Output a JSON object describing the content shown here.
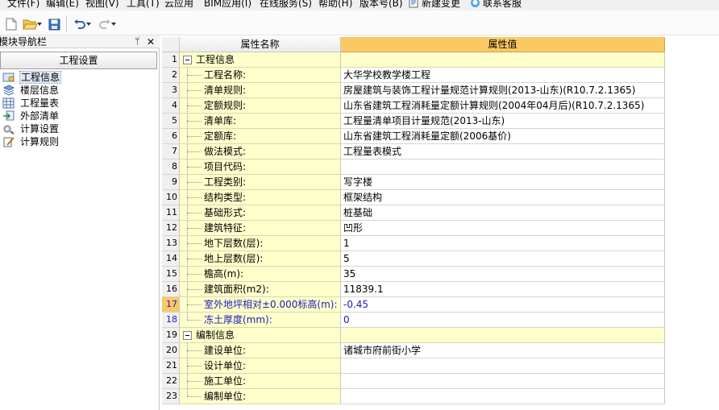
{
  "menu": {
    "items": [
      "文件(F)",
      "编辑(E)",
      "视图(V)",
      "工具(T)",
      "云应用",
      "BIM应用(I)",
      "在线服务(S)",
      "帮助(H)",
      "版本号(B)",
      "新建变更",
      "联系客服"
    ]
  },
  "toolbar": {
    "buttons": [
      "new-file-icon",
      "open-folder-icon",
      "save-icon",
      "undo-icon",
      "redo-icon"
    ]
  },
  "nav": {
    "title": "模块导航栏",
    "pin": "ᛘ",
    "close": "✕",
    "section": "工程设置",
    "items": [
      {
        "label": "工程信息",
        "icon": "project-info-icon"
      },
      {
        "label": "楼层信息",
        "icon": "floor-info-icon"
      },
      {
        "label": "工程量表",
        "icon": "quantity-table-icon"
      },
      {
        "label": "外部清单",
        "icon": "external-list-icon"
      },
      {
        "label": "计算设置",
        "icon": "calc-settings-icon"
      },
      {
        "label": "计算规则",
        "icon": "calc-rules-icon"
      }
    ]
  },
  "grid": {
    "col_name": "属性名称",
    "col_value": "属性值",
    "rows": [
      {
        "num": "1",
        "name": "工程信息",
        "value": ""
      },
      {
        "num": "2",
        "name": "工程名称:",
        "value": "大华学校教学楼工程"
      },
      {
        "num": "3",
        "name": "清单规则:",
        "value": "房屋建筑与装饰工程计量规范计算规则(2013-山东)(R10.7.2.1365)"
      },
      {
        "num": "4",
        "name": "定额规则:",
        "value": "山东省建筑工程消耗量定额计算规则(2004年04月后)(R10.7.2.1365)"
      },
      {
        "num": "5",
        "name": "清单库:",
        "value": "工程量清单项目计量规范(2013-山东)"
      },
      {
        "num": "6",
        "name": "定额库:",
        "value": "山东省建筑工程消耗量定额(2006基价)"
      },
      {
        "num": "7",
        "name": "做法模式:",
        "value": "工程量表模式"
      },
      {
        "num": "8",
        "name": "项目代码:",
        "value": ""
      },
      {
        "num": "9",
        "name": "工程类别:",
        "value": "写字楼"
      },
      {
        "num": "10",
        "name": "结构类型:",
        "value": "框架结构"
      },
      {
        "num": "11",
        "name": "基础形式:",
        "value": "桩基础"
      },
      {
        "num": "12",
        "name": "建筑特征:",
        "value": "凹形"
      },
      {
        "num": "13",
        "name": "地下层数(层):",
        "value": "1"
      },
      {
        "num": "14",
        "name": "地上层数(层):",
        "value": "5"
      },
      {
        "num": "15",
        "name": "檐高(m):",
        "value": "35"
      },
      {
        "num": "16",
        "name": "建筑面积(m2):",
        "value": "11839.1"
      },
      {
        "num": "17",
        "name": "室外地坪相对±0.000标高(m):",
        "value": "-0.45"
      },
      {
        "num": "18",
        "name": "冻土厚度(mm):",
        "value": "0"
      },
      {
        "num": "19",
        "name": "编制信息",
        "value": ""
      },
      {
        "num": "20",
        "name": "建设单位:",
        "value": "诸城市府前街小学"
      },
      {
        "num": "21",
        "name": "设计单位:",
        "value": ""
      },
      {
        "num": "22",
        "name": "施工单位:",
        "value": ""
      },
      {
        "num": "23",
        "name": "编制单位:",
        "value": ""
      }
    ]
  }
}
